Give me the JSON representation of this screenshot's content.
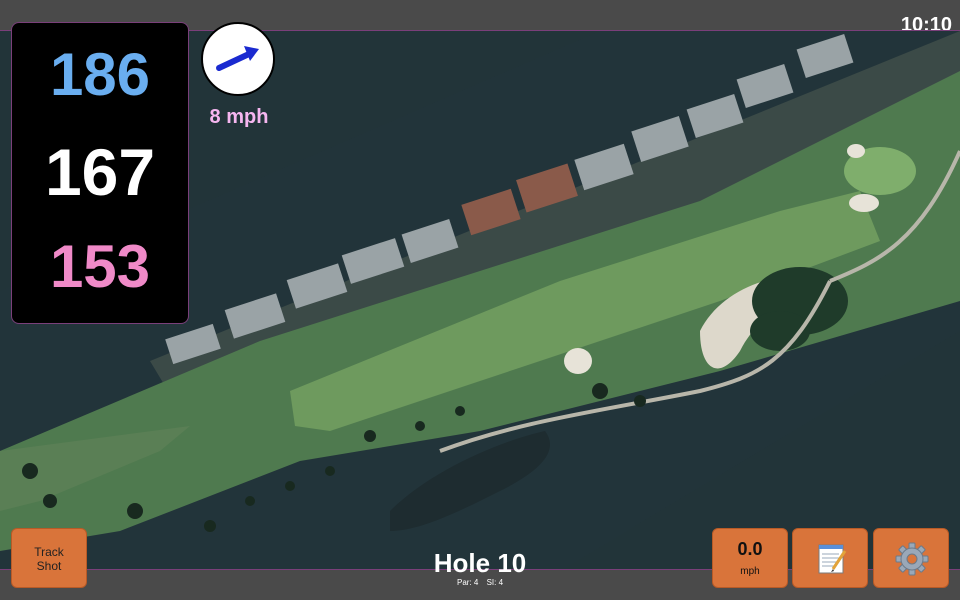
{
  "status": {
    "time": "10:10"
  },
  "distances": {
    "back": "186",
    "center": "167",
    "front": "153"
  },
  "wind": {
    "speed_label": "8 mph",
    "arrow_icon": "wind-direction-arrow-icon"
  },
  "hole": {
    "title": "Hole 10",
    "par_label": "Par: 4",
    "si_label": "SI: 4"
  },
  "buttons": {
    "track_shot": {
      "line1": "Track",
      "line2": "Shot"
    },
    "speed": {
      "value": "0.0",
      "unit": "mph"
    },
    "notes_icon": "notepad-icon",
    "settings_icon": "gear-icon"
  },
  "colors": {
    "back_distance": "#6aaef0",
    "center_distance": "#ffffff",
    "front_distance": "#f08ac8",
    "button": "#d9743a",
    "wind_text": "#f6b6f0"
  }
}
